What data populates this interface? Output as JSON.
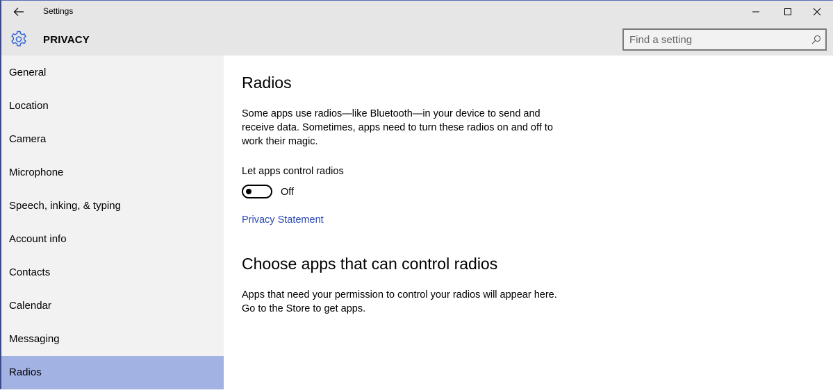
{
  "window": {
    "title": "Settings",
    "controls": {
      "minimize": "minimize",
      "maximize": "maximize",
      "close": "close"
    }
  },
  "header": {
    "section_title": "PRIVACY",
    "search_placeholder": "Find a setting"
  },
  "sidebar": {
    "items": [
      {
        "label": "General"
      },
      {
        "label": "Location"
      },
      {
        "label": "Camera"
      },
      {
        "label": "Microphone"
      },
      {
        "label": "Speech, inking, & typing"
      },
      {
        "label": "Account info"
      },
      {
        "label": "Contacts"
      },
      {
        "label": "Calendar"
      },
      {
        "label": "Messaging"
      },
      {
        "label": "Radios"
      }
    ],
    "active": "Radios"
  },
  "main": {
    "title": "Radios",
    "description": "Some apps use radios—like Bluetooth—in your device to send and receive data. Sometimes, apps need to turn these radios on and off to work their magic.",
    "toggle_label": "Let apps control radios",
    "toggle_state": "Off",
    "toggle_on": false,
    "privacy_link": "Privacy Statement",
    "section2_title": "Choose apps that can control radios",
    "section2_description": "Apps that need your permission to control your radios will appear here. Go to the Store to get apps."
  },
  "colors": {
    "accent": "#2949b4",
    "active_nav": "#a2b2e3",
    "sidebar_bg": "#f2f2f2",
    "header_bg": "#e6e6e6"
  }
}
